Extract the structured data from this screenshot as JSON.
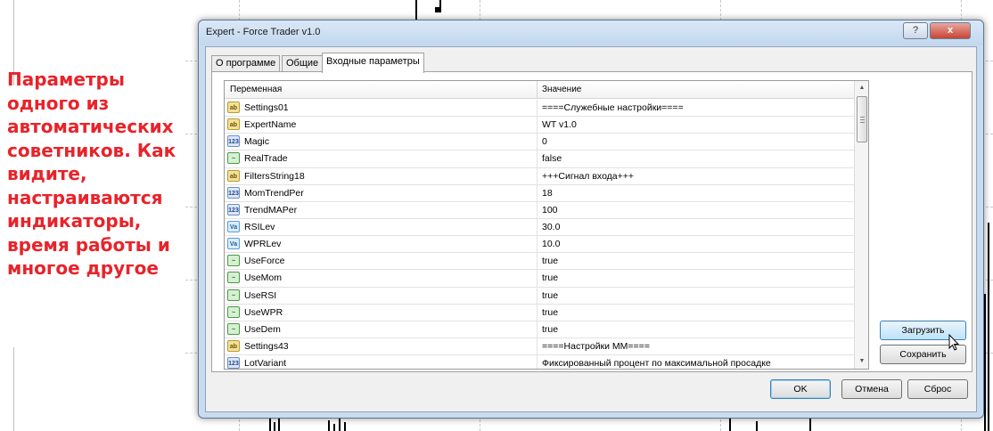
{
  "caption": {
    "lines": [
      "Параметры",
      "одного из",
      "автоматических",
      "советников. Как",
      "видите,",
      "настраиваются",
      "индикаторы,",
      "время работы и",
      "многое другое"
    ]
  },
  "window": {
    "title": "Expert - Force Trader v1.0",
    "help_label": "?",
    "close_label": "x"
  },
  "tabs": [
    {
      "label": "О программе",
      "active": false
    },
    {
      "label": "Общие",
      "active": false
    },
    {
      "label": "Входные параметры",
      "active": true
    }
  ],
  "grid": {
    "columns": [
      "Переменная",
      "Значение"
    ],
    "rows": [
      {
        "type": "ab",
        "name": "Settings01",
        "value": "====Служебные настройки===="
      },
      {
        "type": "ab",
        "name": "ExpertName",
        "value": "WT v1.0"
      },
      {
        "type": "123",
        "name": "Magic",
        "value": "0"
      },
      {
        "type": "bool",
        "name": "RealTrade",
        "value": "false"
      },
      {
        "type": "ab",
        "name": "FiltersString18",
        "value": "+++Сигнал входа+++"
      },
      {
        "type": "123",
        "name": "MomTrendPer",
        "value": "18"
      },
      {
        "type": "123",
        "name": "TrendMAPer",
        "value": "100"
      },
      {
        "type": "va",
        "name": "RSILev",
        "value": "30.0"
      },
      {
        "type": "va",
        "name": "WPRLev",
        "value": "10.0"
      },
      {
        "type": "bool",
        "name": "UseForce",
        "value": "true"
      },
      {
        "type": "bool",
        "name": "UseMom",
        "value": "true"
      },
      {
        "type": "bool",
        "name": "UseRSI",
        "value": "true"
      },
      {
        "type": "bool",
        "name": "UseWPR",
        "value": "true"
      },
      {
        "type": "bool",
        "name": "UseDem",
        "value": "true"
      },
      {
        "type": "ab",
        "name": "Settings43",
        "value": "====Настройки ММ===="
      },
      {
        "type": "123",
        "name": "LotVariant",
        "value": "Фиксированный процент по максимальной просадке"
      }
    ]
  },
  "type_icons": {
    "ab": "ab",
    "123": "123",
    "bool": "~",
    "va": "Va"
  },
  "side_buttons": {
    "load": "Загрузить",
    "save": "Сохранить"
  },
  "footer_buttons": {
    "ok": "OK",
    "cancel": "Отмена",
    "reset": "Сброс"
  },
  "colors": {
    "caption": "#e8232a",
    "window_frame": "#c9dbef"
  }
}
